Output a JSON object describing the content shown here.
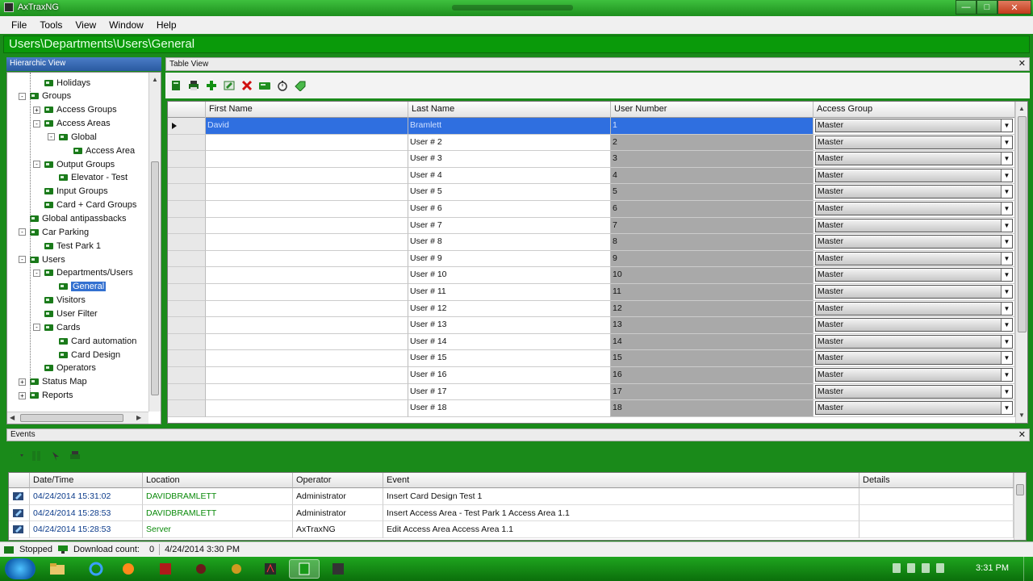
{
  "window": {
    "title": "AxTraxNG"
  },
  "menu": [
    "File",
    "Tools",
    "View",
    "Window",
    "Help"
  ],
  "breadcrumb": "Users\\Departments\\Users\\General",
  "hierarchic": {
    "title": "Hierarchic View",
    "nodes": [
      {
        "label": "Holidays",
        "icon": "palm-tree-icon",
        "level": 2,
        "exp": ""
      },
      {
        "label": "Groups",
        "icon": "groups-icon",
        "level": 1,
        "exp": "-"
      },
      {
        "label": "Access Groups",
        "icon": "access-groups-icon",
        "level": 2,
        "exp": "+"
      },
      {
        "label": "Access Areas",
        "icon": "access-area-icon",
        "level": 2,
        "exp": "-"
      },
      {
        "label": "Global",
        "icon": "access-area-icon",
        "level": 3,
        "exp": "-"
      },
      {
        "label": "Access Area",
        "icon": "access-area-icon",
        "level": 4,
        "exp": ""
      },
      {
        "label": "Output Groups",
        "icon": "output-groups-icon",
        "level": 2,
        "exp": "-"
      },
      {
        "label": "Elevator - Test",
        "icon": "output-groups-icon",
        "level": 3,
        "exp": ""
      },
      {
        "label": "Input Groups",
        "icon": "input-groups-icon",
        "level": 2,
        "exp": ""
      },
      {
        "label": "Card + Card Groups",
        "icon": "card-groups-icon",
        "level": 2,
        "exp": ""
      },
      {
        "label": "Global antipassbacks",
        "icon": "antipassback-icon",
        "level": 1,
        "exp": ""
      },
      {
        "label": "Car Parking",
        "icon": "car-parking-icon",
        "level": 1,
        "exp": "-"
      },
      {
        "label": "Test Park 1",
        "icon": "car-parking-icon",
        "level": 2,
        "exp": ""
      },
      {
        "label": "Users",
        "icon": "users-icon",
        "level": 1,
        "exp": "-"
      },
      {
        "label": "Departments/Users",
        "icon": "departments-icon",
        "level": 2,
        "exp": "-"
      },
      {
        "label": "General",
        "icon": "department-icon",
        "level": 3,
        "exp": "",
        "selected": true
      },
      {
        "label": "Visitors",
        "icon": "visitors-icon",
        "level": 2,
        "exp": ""
      },
      {
        "label": "User Filter",
        "icon": "filter-icon",
        "level": 2,
        "exp": ""
      },
      {
        "label": "Cards",
        "icon": "cards-icon",
        "level": 2,
        "exp": "-"
      },
      {
        "label": "Card automation",
        "icon": "cards-icon",
        "level": 3,
        "exp": ""
      },
      {
        "label": "Card Design",
        "icon": "card-design-icon",
        "level": 3,
        "exp": ""
      },
      {
        "label": "Operators",
        "icon": "operators-icon",
        "level": 2,
        "exp": ""
      },
      {
        "label": "Status Map",
        "icon": "status-map-icon",
        "level": 1,
        "exp": "+"
      },
      {
        "label": "Reports",
        "icon": "reports-icon",
        "level": 1,
        "exp": "+"
      }
    ]
  },
  "table_view": {
    "title": "Table View",
    "columns": [
      "First Name",
      "Last Name",
      "User Number",
      "Access Group"
    ],
    "rows": [
      {
        "first": "David",
        "last": "Bramlett",
        "num": "1",
        "access": "Master",
        "selected": true
      },
      {
        "first": "",
        "last": "User # 2",
        "num": "2",
        "access": "Master"
      },
      {
        "first": "",
        "last": "User # 3",
        "num": "3",
        "access": "Master"
      },
      {
        "first": "",
        "last": "User # 4",
        "num": "4",
        "access": "Master"
      },
      {
        "first": "",
        "last": "User # 5",
        "num": "5",
        "access": "Master"
      },
      {
        "first": "",
        "last": "User # 6",
        "num": "6",
        "access": "Master"
      },
      {
        "first": "",
        "last": "User # 7",
        "num": "7",
        "access": "Master"
      },
      {
        "first": "",
        "last": "User # 8",
        "num": "8",
        "access": "Master"
      },
      {
        "first": "",
        "last": "User # 9",
        "num": "9",
        "access": "Master"
      },
      {
        "first": "",
        "last": "User # 10",
        "num": "10",
        "access": "Master"
      },
      {
        "first": "",
        "last": "User # 11",
        "num": "11",
        "access": "Master"
      },
      {
        "first": "",
        "last": "User # 12",
        "num": "12",
        "access": "Master"
      },
      {
        "first": "",
        "last": "User # 13",
        "num": "13",
        "access": "Master"
      },
      {
        "first": "",
        "last": "User # 14",
        "num": "14",
        "access": "Master"
      },
      {
        "first": "",
        "last": "User # 15",
        "num": "15",
        "access": "Master"
      },
      {
        "first": "",
        "last": "User # 16",
        "num": "16",
        "access": "Master"
      },
      {
        "first": "",
        "last": "User # 17",
        "num": "17",
        "access": "Master"
      },
      {
        "first": "",
        "last": "User # 18",
        "num": "18",
        "access": "Master"
      }
    ]
  },
  "events": {
    "title": "Events",
    "columns": [
      "Date/Time",
      "Location",
      "Operator",
      "Event",
      "Details"
    ],
    "rows": [
      {
        "datetime": "04/24/2014 15:31:02",
        "location": "DAVIDBRAMLETT",
        "operator": "Administrator",
        "event": "Insert Card Design Test 1",
        "details": ""
      },
      {
        "datetime": "04/24/2014 15:28:53",
        "location": "DAVIDBRAMLETT",
        "operator": "Administrator",
        "event": "Insert Access Area - Test Park 1 Access Area 1.1",
        "details": ""
      },
      {
        "datetime": "04/24/2014 15:28:53",
        "location": "Server",
        "operator": "AxTraxNG",
        "event": "Edit Access Area Access Area 1.1",
        "details": ""
      }
    ]
  },
  "status": {
    "state": "Stopped",
    "download_label": "Download count:",
    "download_count": "0",
    "datetime": "4/24/2014 3:30 PM"
  },
  "taskbar": {
    "clock": "3:31 PM"
  },
  "colors": {
    "accent_green": "#0a9a0a",
    "selection_blue": "#2f6fe0",
    "number_col_gray": "#a9a9a9"
  }
}
